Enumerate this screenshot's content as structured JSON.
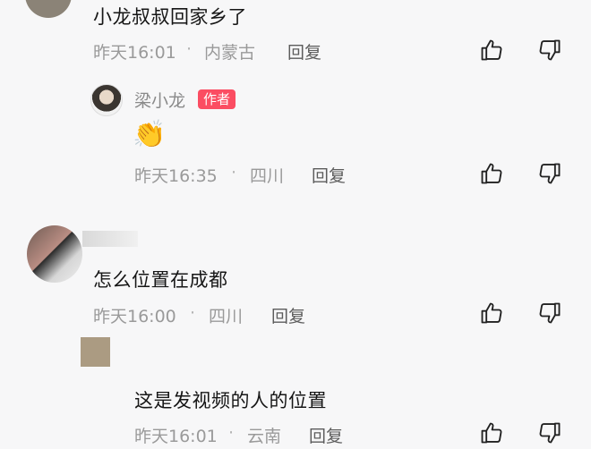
{
  "comments": [
    {
      "text": "小龙叔叔回家乡了",
      "time": "昨天16:01",
      "location": "内蒙古",
      "reply_label": "回复",
      "reply": {
        "author": "梁小龙",
        "badge": "作者",
        "text": "👏",
        "time": "昨天16:35",
        "location": "四川",
        "reply_label": "回复"
      }
    },
    {
      "text": "怎么位置在成都",
      "time": "昨天16:00",
      "location": "四川",
      "reply_label": "回复",
      "reply": {
        "author": "",
        "text": "这是发视频的人的位置",
        "time": "昨天16:01",
        "location": "云南",
        "reply_label": "回复"
      }
    }
  ],
  "separator": "·",
  "icons": {
    "like": "thumbs-up-icon",
    "dislike": "thumbs-down-icon"
  },
  "colors": {
    "badge": "#fb4d62",
    "meta": "#9a9a9a",
    "text": "#161616"
  }
}
